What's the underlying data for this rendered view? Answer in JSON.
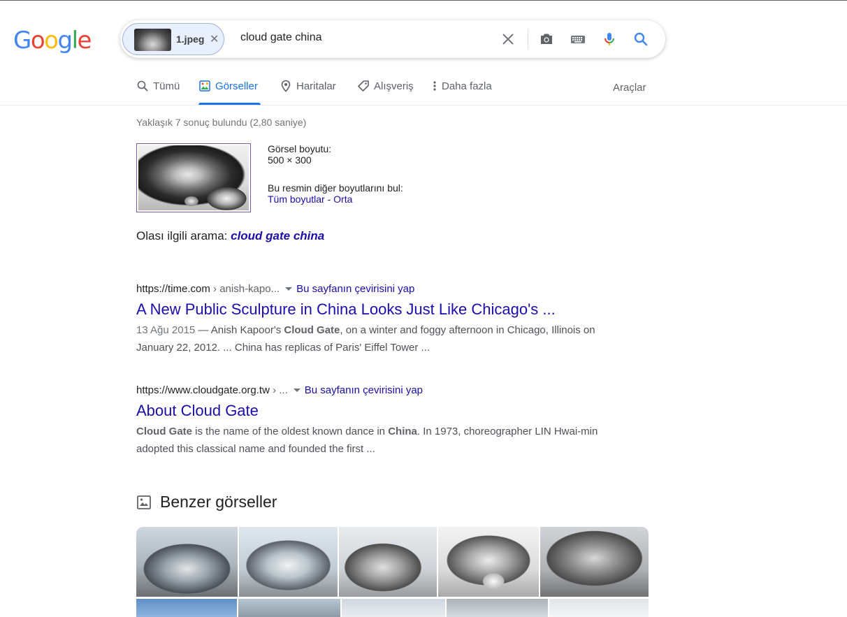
{
  "logo": {
    "letters": [
      "G",
      "o",
      "o",
      "g",
      "l",
      "e"
    ],
    "colors": [
      "#4285F4",
      "#EA4335",
      "#FBBC05",
      "#4285F4",
      "#34A853",
      "#EA4335"
    ]
  },
  "search": {
    "chip_name": "1.jpeg",
    "query": "cloud gate china",
    "icons": [
      "clear-icon",
      "camera-icon",
      "keyboard-icon",
      "mic-icon",
      "search-icon"
    ]
  },
  "tabs": [
    {
      "label": "Tümü",
      "icon": "search-icon"
    },
    {
      "label": "Görseller",
      "icon": "image-icon",
      "active": true
    },
    {
      "label": "Haritalar",
      "icon": "pin-icon"
    },
    {
      "label": "Alışveriş",
      "icon": "tag-icon"
    },
    {
      "label": "Daha fazla",
      "icon": "more-vert-icon"
    }
  ],
  "tools_label": "Araçlar",
  "stats": "Yaklaşık 7 sonuç bulundu (2,80 saniye)",
  "image_info": {
    "size_label": "Görsel boyutu:",
    "size_value": "500 × 300",
    "other_sizes_label": "Bu resmin diğer boyutlarını bul:",
    "all_sizes": "Tüm boyutlar",
    "sep": " - ",
    "medium": "Orta"
  },
  "related": {
    "label": "Olası ilgili arama: ",
    "query": "cloud gate china"
  },
  "results": [
    {
      "host": "https://time.com",
      "path": " › anish-kapo...",
      "translate": "Bu sayfanın çevirisini yap",
      "title": "A New Public Sculpture in China Looks Just Like Chicago's ...",
      "date": "13 Ağu 2015",
      "snippet_pre": " — Anish Kapoor's ",
      "snippet_bold": "Cloud Gate",
      "snippet_post": ", on a winter and foggy afternoon in Chicago, Illinois on January 22, 2012. ... China has replicas of Paris' Eiffel Tower ..."
    },
    {
      "host": "https://www.cloudgate.org.tw",
      "path": " › ...",
      "translate": "Bu sayfanın çevirisini yap",
      "title": "About Cloud Gate",
      "snippet_bold1": "Cloud Gate",
      "snippet_mid": " is the name of the oldest known dance in ",
      "snippet_bold2": "China",
      "snippet_post": ". In 1973, choreographer LIN Hwai-min adopted this classical name and founded the first ..."
    }
  ],
  "similar": {
    "heading": "Benzer görseller"
  }
}
